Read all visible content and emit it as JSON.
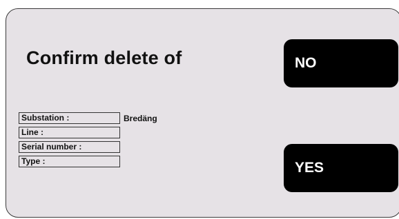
{
  "dialog": {
    "title": "Confirm delete of",
    "no_label": "NO",
    "yes_label": "YES",
    "fields": [
      {
        "label": "Substation :",
        "value": "Bredäng"
      },
      {
        "label": "Line :",
        "value": ""
      },
      {
        "label": "Serial number :",
        "value": ""
      },
      {
        "label": "Type :",
        "value": ""
      }
    ]
  },
  "colors": {
    "dialog_background": "#e6e2e6",
    "button_background": "#000000",
    "button_text": "#ffffff",
    "accent": "#2aa3d8"
  }
}
